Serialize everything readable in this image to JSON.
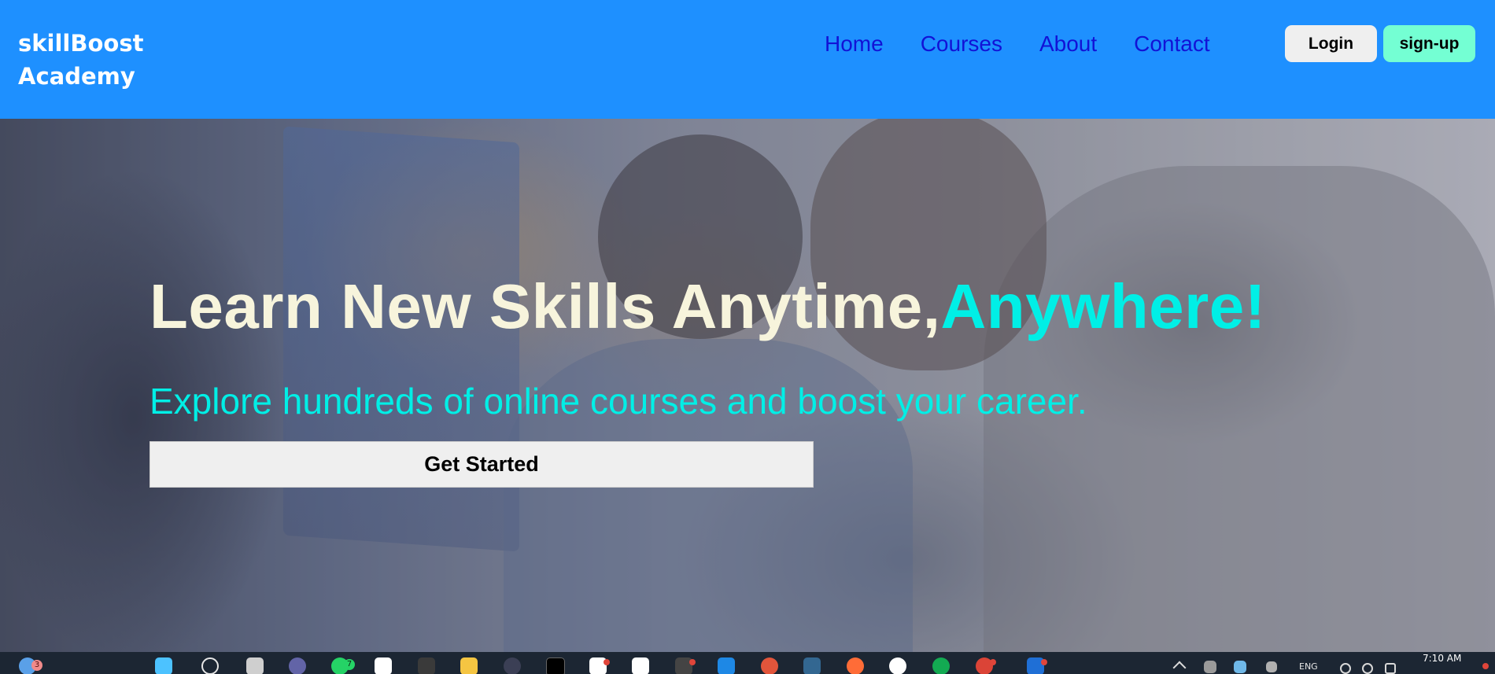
{
  "header": {
    "logo_line1": "skillBoost",
    "logo_line2": "Academy",
    "nav": [
      {
        "label": "Home"
      },
      {
        "label": "Courses"
      },
      {
        "label": "About"
      },
      {
        "label": "Contact"
      }
    ],
    "login_label": "Login",
    "signup_label": "sign-up"
  },
  "hero": {
    "headline_main": "Learn New Skills Anytime,",
    "headline_accent": "Anywhere!",
    "subheadline": "Explore hundreds of online courses and boost your career.",
    "cta_label": "Get Started"
  },
  "taskbar": {
    "weather_badge": "3",
    "app_badge": "7",
    "language": "ENG",
    "time": "7:10 AM"
  },
  "colors": {
    "header_bg": "#1e90ff",
    "nav_link": "#1212d6",
    "signup_bg": "#74ffd3",
    "headline": "#f7f4dc",
    "accent_cyan": "#00efe6",
    "cta_bg": "#efefef",
    "taskbar_bg": "#1c2633"
  },
  "icons": [
    "weather-icon",
    "start-icon",
    "search-icon",
    "task-view-icon",
    "teams-icon",
    "whatsapp-icon",
    "notion-icon",
    "app-icon",
    "file-explorer-icon",
    "app-icon",
    "medium-icon",
    "app-icon",
    "app-icon",
    "app-icon",
    "vscode-icon",
    "app-icon",
    "postgres-icon",
    "postman-icon",
    "inkscape-icon",
    "mongodb-icon",
    "chrome-icon",
    "app-icon",
    "overflow-icon",
    "tray-chevron-icon",
    "network-icon",
    "volume-icon",
    "battery-icon"
  ]
}
